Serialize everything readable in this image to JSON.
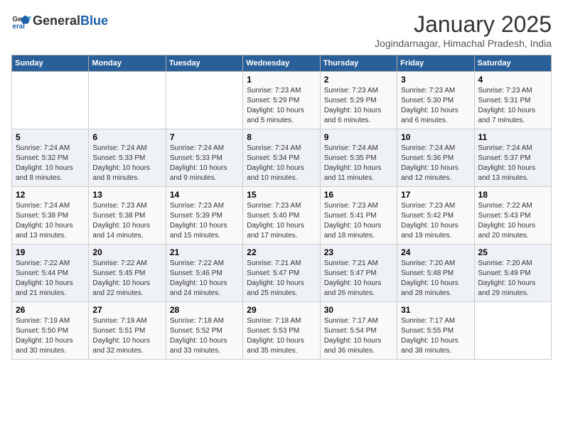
{
  "header": {
    "logo_text_general": "General",
    "logo_text_blue": "Blue",
    "month_title": "January 2025",
    "subtitle": "Jogindarnagar, Himachal Pradesh, India"
  },
  "weekdays": [
    "Sunday",
    "Monday",
    "Tuesday",
    "Wednesday",
    "Thursday",
    "Friday",
    "Saturday"
  ],
  "weeks": [
    [
      {
        "day": "",
        "detail": ""
      },
      {
        "day": "",
        "detail": ""
      },
      {
        "day": "",
        "detail": ""
      },
      {
        "day": "1",
        "detail": "Sunrise: 7:23 AM\nSunset: 5:29 PM\nDaylight: 10 hours\nand 5 minutes."
      },
      {
        "day": "2",
        "detail": "Sunrise: 7:23 AM\nSunset: 5:29 PM\nDaylight: 10 hours\nand 6 minutes."
      },
      {
        "day": "3",
        "detail": "Sunrise: 7:23 AM\nSunset: 5:30 PM\nDaylight: 10 hours\nand 6 minutes."
      },
      {
        "day": "4",
        "detail": "Sunrise: 7:23 AM\nSunset: 5:31 PM\nDaylight: 10 hours\nand 7 minutes."
      }
    ],
    [
      {
        "day": "5",
        "detail": "Sunrise: 7:24 AM\nSunset: 5:32 PM\nDaylight: 10 hours\nand 8 minutes."
      },
      {
        "day": "6",
        "detail": "Sunrise: 7:24 AM\nSunset: 5:33 PM\nDaylight: 10 hours\nand 8 minutes."
      },
      {
        "day": "7",
        "detail": "Sunrise: 7:24 AM\nSunset: 5:33 PM\nDaylight: 10 hours\nand 9 minutes."
      },
      {
        "day": "8",
        "detail": "Sunrise: 7:24 AM\nSunset: 5:34 PM\nDaylight: 10 hours\nand 10 minutes."
      },
      {
        "day": "9",
        "detail": "Sunrise: 7:24 AM\nSunset: 5:35 PM\nDaylight: 10 hours\nand 11 minutes."
      },
      {
        "day": "10",
        "detail": "Sunrise: 7:24 AM\nSunset: 5:36 PM\nDaylight: 10 hours\nand 12 minutes."
      },
      {
        "day": "11",
        "detail": "Sunrise: 7:24 AM\nSunset: 5:37 PM\nDaylight: 10 hours\nand 13 minutes."
      }
    ],
    [
      {
        "day": "12",
        "detail": "Sunrise: 7:24 AM\nSunset: 5:38 PM\nDaylight: 10 hours\nand 13 minutes."
      },
      {
        "day": "13",
        "detail": "Sunrise: 7:23 AM\nSunset: 5:38 PM\nDaylight: 10 hours\nand 14 minutes."
      },
      {
        "day": "14",
        "detail": "Sunrise: 7:23 AM\nSunset: 5:39 PM\nDaylight: 10 hours\nand 15 minutes."
      },
      {
        "day": "15",
        "detail": "Sunrise: 7:23 AM\nSunset: 5:40 PM\nDaylight: 10 hours\nand 17 minutes."
      },
      {
        "day": "16",
        "detail": "Sunrise: 7:23 AM\nSunset: 5:41 PM\nDaylight: 10 hours\nand 18 minutes."
      },
      {
        "day": "17",
        "detail": "Sunrise: 7:23 AM\nSunset: 5:42 PM\nDaylight: 10 hours\nand 19 minutes."
      },
      {
        "day": "18",
        "detail": "Sunrise: 7:22 AM\nSunset: 5:43 PM\nDaylight: 10 hours\nand 20 minutes."
      }
    ],
    [
      {
        "day": "19",
        "detail": "Sunrise: 7:22 AM\nSunset: 5:44 PM\nDaylight: 10 hours\nand 21 minutes."
      },
      {
        "day": "20",
        "detail": "Sunrise: 7:22 AM\nSunset: 5:45 PM\nDaylight: 10 hours\nand 22 minutes."
      },
      {
        "day": "21",
        "detail": "Sunrise: 7:22 AM\nSunset: 5:46 PM\nDaylight: 10 hours\nand 24 minutes."
      },
      {
        "day": "22",
        "detail": "Sunrise: 7:21 AM\nSunset: 5:47 PM\nDaylight: 10 hours\nand 25 minutes."
      },
      {
        "day": "23",
        "detail": "Sunrise: 7:21 AM\nSunset: 5:47 PM\nDaylight: 10 hours\nand 26 minutes."
      },
      {
        "day": "24",
        "detail": "Sunrise: 7:20 AM\nSunset: 5:48 PM\nDaylight: 10 hours\nand 28 minutes."
      },
      {
        "day": "25",
        "detail": "Sunrise: 7:20 AM\nSunset: 5:49 PM\nDaylight: 10 hours\nand 29 minutes."
      }
    ],
    [
      {
        "day": "26",
        "detail": "Sunrise: 7:19 AM\nSunset: 5:50 PM\nDaylight: 10 hours\nand 30 minutes."
      },
      {
        "day": "27",
        "detail": "Sunrise: 7:19 AM\nSunset: 5:51 PM\nDaylight: 10 hours\nand 32 minutes."
      },
      {
        "day": "28",
        "detail": "Sunrise: 7:18 AM\nSunset: 5:52 PM\nDaylight: 10 hours\nand 33 minutes."
      },
      {
        "day": "29",
        "detail": "Sunrise: 7:18 AM\nSunset: 5:53 PM\nDaylight: 10 hours\nand 35 minutes."
      },
      {
        "day": "30",
        "detail": "Sunrise: 7:17 AM\nSunset: 5:54 PM\nDaylight: 10 hours\nand 36 minutes."
      },
      {
        "day": "31",
        "detail": "Sunrise: 7:17 AM\nSunset: 5:55 PM\nDaylight: 10 hours\nand 38 minutes."
      },
      {
        "day": "",
        "detail": ""
      }
    ]
  ]
}
